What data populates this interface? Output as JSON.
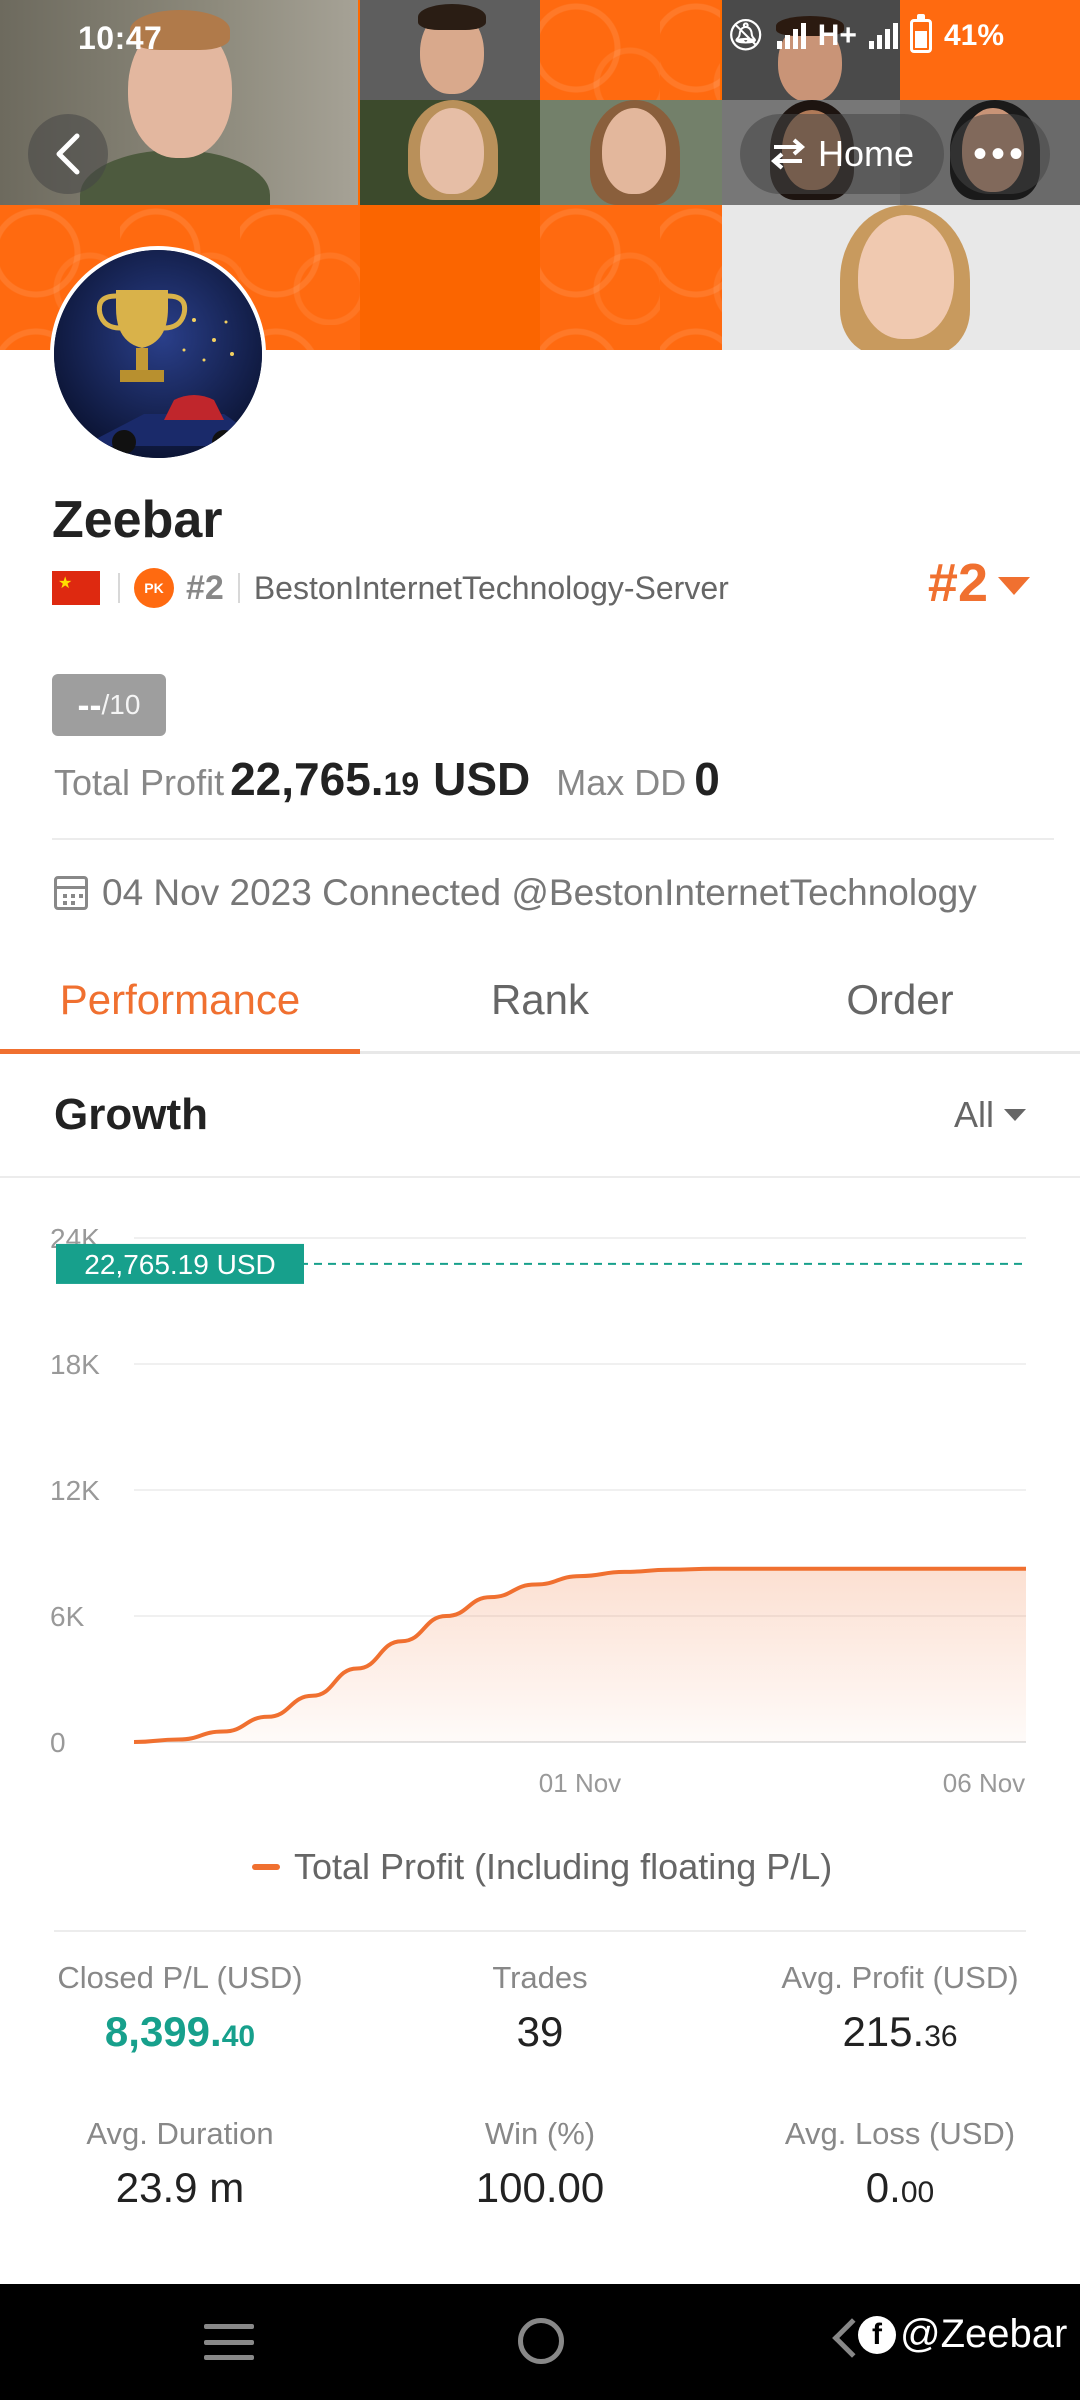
{
  "status_bar": {
    "time": "10:47",
    "network": "H+",
    "battery": "41%"
  },
  "header": {
    "home_label": "Home",
    "more_label": "•••"
  },
  "profile": {
    "name": "Zeebar",
    "pk_label": "PK",
    "rank_small": "#2",
    "server": "BestonInternetTechnology-Server",
    "rank_big": "#2",
    "score_main": "--",
    "score_total": "/10",
    "total_profit_label": "Total Profit",
    "total_profit_int": "22,765.",
    "total_profit_dec": "19",
    "total_profit_currency": "USD",
    "max_dd_label": "Max DD",
    "max_dd_value": "0",
    "connected_text": "04 Nov 2023 Connected @BestonInternetTechnology"
  },
  "tabs": [
    {
      "label": "Performance",
      "active": true
    },
    {
      "label": "Rank",
      "active": false
    },
    {
      "label": "Order",
      "active": false
    }
  ],
  "growth": {
    "title": "Growth",
    "filter": "All"
  },
  "chart_data": {
    "type": "area",
    "y_ticks": [
      "24K",
      "18K",
      "12K",
      "6K",
      "0"
    ],
    "ylim": [
      0,
      24000
    ],
    "x_ticks": [
      "01 Nov",
      "06 Nov"
    ],
    "current_value_label": "22,765.19 USD",
    "current_value": 22765.19,
    "series": [
      {
        "name": "Total Profit (Including floating P/L)",
        "color": "#f07030",
        "values": [
          0,
          120,
          500,
          1200,
          2200,
          3500,
          4800,
          6000,
          6900,
          7500,
          7900,
          8100,
          8200,
          8250,
          8250,
          8250,
          8250,
          8250,
          8250,
          8250,
          8250
        ]
      }
    ],
    "legend": "Total Profit (Including floating P/L)",
    "grid": true,
    "legend_position": "bottom"
  },
  "stats": [
    {
      "label": "Closed P/L (USD)",
      "int": "8,399.",
      "dec": "40",
      "style": "teal"
    },
    {
      "label": "Trades",
      "int": "39",
      "dec": "",
      "style": "normal"
    },
    {
      "label": "Avg. Profit (USD)",
      "int": "215.",
      "dec": "36",
      "style": "normal"
    },
    {
      "label": "Avg. Duration",
      "int": "23.9 m",
      "dec": "",
      "style": "normal"
    },
    {
      "label": "Win (%)",
      "int": "100.00",
      "dec": "",
      "style": "normal"
    },
    {
      "label": "Avg. Loss (USD)",
      "int": "0.",
      "dec": "00",
      "style": "normal"
    }
  ],
  "watermark": {
    "icon": "f",
    "text": "@Zeebar"
  },
  "colors": {
    "accent": "#f07030",
    "teal": "#17a08c",
    "banner_orange": "#ff6a10"
  }
}
